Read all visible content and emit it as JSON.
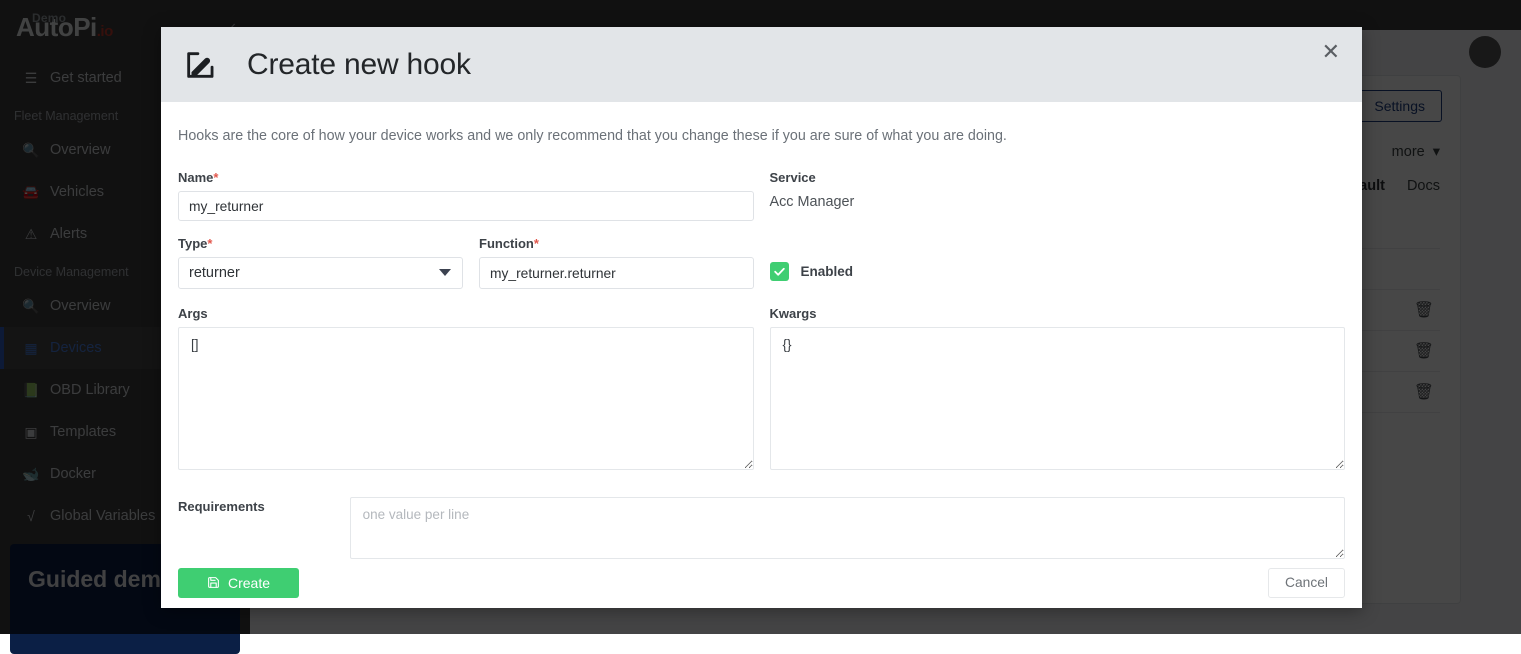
{
  "sidebar": {
    "brand_demo": "Demo",
    "brand_name": "AutoPi",
    "brand_tld": ".io",
    "get_started": "Get started",
    "sections": [
      {
        "title": "Fleet Management",
        "items": [
          {
            "label": "Overview",
            "icon": "magnifier-icon"
          },
          {
            "label": "Vehicles",
            "icon": "car-icon"
          },
          {
            "label": "Alerts",
            "icon": "alert-icon"
          }
        ]
      },
      {
        "title": "Device Management",
        "items": [
          {
            "label": "Overview",
            "icon": "magnifier-icon"
          },
          {
            "label": "Devices",
            "icon": "devices-icon",
            "active": true
          },
          {
            "label": "OBD Library",
            "icon": "book-icon"
          },
          {
            "label": "Templates",
            "icon": "templates-icon"
          },
          {
            "label": "Docker",
            "icon": "docker-icon"
          },
          {
            "label": "Global Variables",
            "icon": "sqrt-icon"
          }
        ]
      }
    ],
    "guided_demo_title": "Guided demo?"
  },
  "background": {
    "settings_button": "Settings",
    "more_dropdown": "more",
    "tab_default": "default",
    "tab_docs": "Docs"
  },
  "modal": {
    "title": "Create new hook",
    "title_icon": "edit-pencil-icon",
    "close_icon": "close-icon",
    "description": "Hooks are the core of how your device works and we only recommend that you change these if you are sure of what you are doing.",
    "fields": {
      "name": {
        "label": "Name",
        "required": "*",
        "value": "my_returner"
      },
      "service": {
        "label": "Service",
        "value": "Acc Manager"
      },
      "type": {
        "label": "Type",
        "required": "*",
        "value": "returner"
      },
      "function": {
        "label": "Function",
        "required": "*",
        "value": "my_returner.returner"
      },
      "enabled": {
        "label": "Enabled",
        "checked": true
      },
      "args": {
        "label": "Args",
        "value": "[]"
      },
      "kwargs": {
        "label": "Kwargs",
        "value": "{}"
      },
      "requirements": {
        "label": "Requirements",
        "value": "",
        "placeholder": "one value per line"
      }
    },
    "create_button": "Create",
    "create_button_icon": "save-icon",
    "cancel_button": "Cancel"
  },
  "colors": {
    "accent_green": "#3fce72",
    "required_red": "#e2574c",
    "active_blue": "#4a7fe0",
    "header_grey": "#e2e5e8"
  }
}
